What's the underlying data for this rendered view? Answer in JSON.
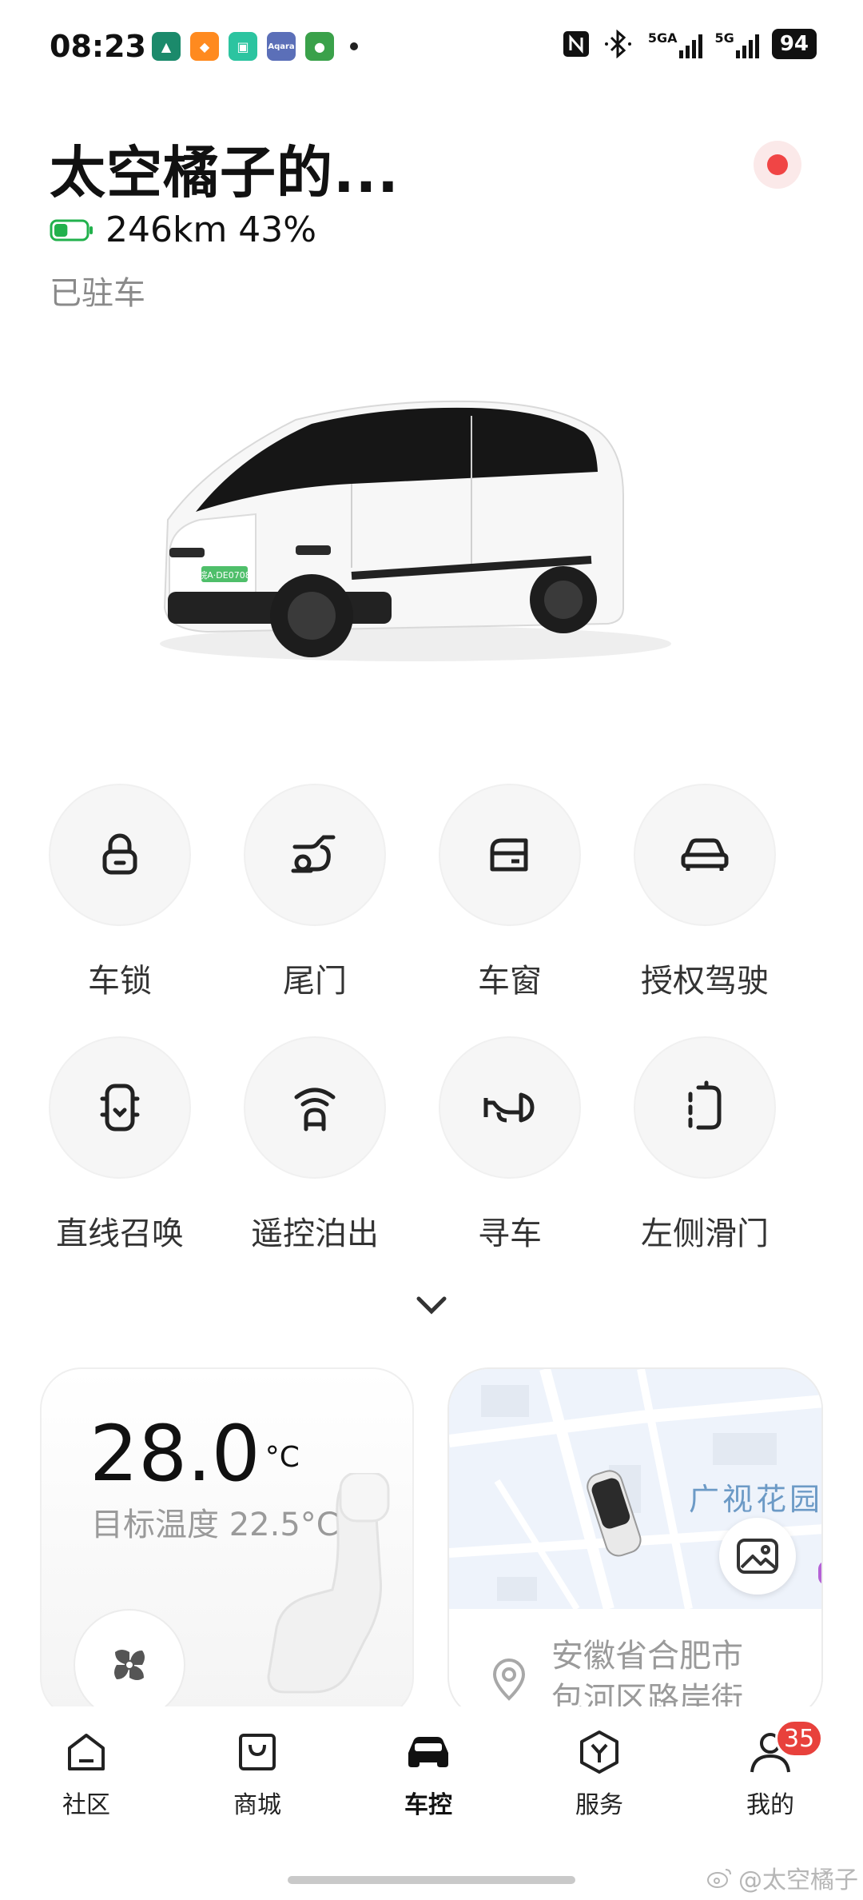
{
  "status_bar": {
    "time": "08:23",
    "signal_1_label": "5GA",
    "signal_2_label": "5G",
    "battery": "94",
    "apps": [
      {
        "name": "app-icon-1",
        "color": "#1b8a6b"
      },
      {
        "name": "app-icon-2",
        "color": "#ff8a1f"
      },
      {
        "name": "app-icon-3",
        "color": "#2cc4a0"
      },
      {
        "name": "aqara-icon",
        "color": "#5b6fb8",
        "text": "Aqara"
      },
      {
        "name": "app-icon-5",
        "color": "#3aa14a"
      }
    ]
  },
  "header": {
    "car_name": "太空橘子的...",
    "range": "246km 43%",
    "battery_percent": 43,
    "battery_color": "#22b14c",
    "state": "已驻车"
  },
  "car": {
    "plate": "皖A·DE0708"
  },
  "controls": [
    {
      "id": "lock",
      "label": "车锁",
      "icon": "lock-icon"
    },
    {
      "id": "tailgate",
      "label": "尾门",
      "icon": "tailgate-icon"
    },
    {
      "id": "window",
      "label": "车窗",
      "icon": "window-icon"
    },
    {
      "id": "authorized-drive",
      "label": "授权驾驶",
      "icon": "authorized-drive-icon"
    },
    {
      "id": "summon",
      "label": "直线召唤",
      "icon": "summon-icon"
    },
    {
      "id": "remote-park-out",
      "label": "遥控泊出",
      "icon": "remote-park-out-icon"
    },
    {
      "id": "find-car",
      "label": "寻车",
      "icon": "horn-icon"
    },
    {
      "id": "left-sliding-door",
      "label": "左侧滑门",
      "icon": "sliding-door-icon"
    }
  ],
  "climate": {
    "current_temp": "28.0",
    "unit": "°C",
    "target": "目标温度 22.5°C"
  },
  "map": {
    "poi_label": "广视花园",
    "address_line1": "安徽省合肥市",
    "address_line2": "包河区路岸街"
  },
  "bottom_nav": {
    "items": [
      {
        "label": "社区",
        "icon": "community-icon",
        "active": false
      },
      {
        "label": "商城",
        "icon": "shop-icon",
        "active": false
      },
      {
        "label": "车控",
        "icon": "car-control-icon",
        "active": true
      },
      {
        "label": "服务",
        "icon": "service-icon",
        "active": false
      },
      {
        "label": "我的",
        "icon": "profile-icon",
        "active": false,
        "badge": "35"
      }
    ]
  },
  "watermark": "@太空橘子"
}
